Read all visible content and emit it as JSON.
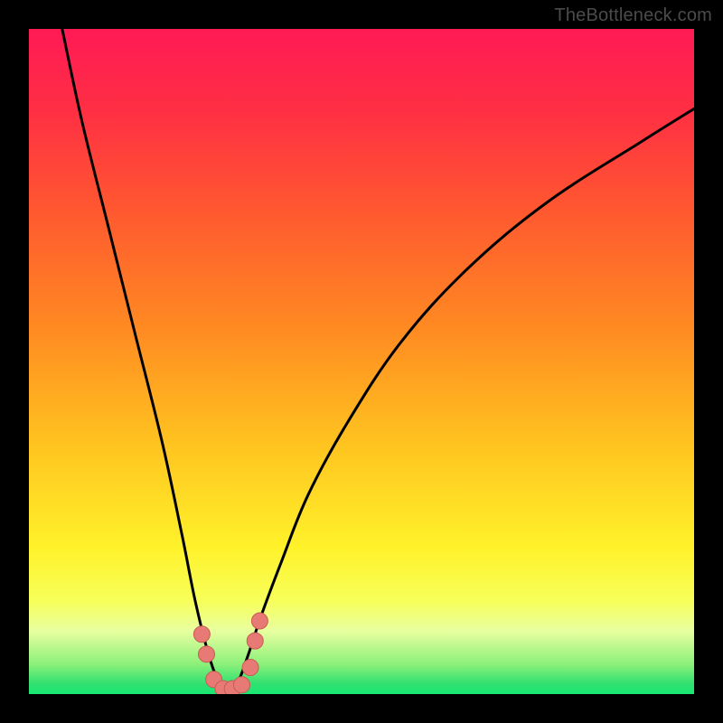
{
  "watermark": "TheBottleneck.com",
  "colors": {
    "frame": "#000000",
    "gradient_stops": [
      {
        "offset": 0.0,
        "color": "#ff1a55"
      },
      {
        "offset": 0.12,
        "color": "#ff2e44"
      },
      {
        "offset": 0.28,
        "color": "#ff5a2f"
      },
      {
        "offset": 0.45,
        "color": "#ff8a22"
      },
      {
        "offset": 0.62,
        "color": "#ffc21f"
      },
      {
        "offset": 0.78,
        "color": "#fff22a"
      },
      {
        "offset": 0.86,
        "color": "#f7ff5a"
      },
      {
        "offset": 0.905,
        "color": "#e8ffa0"
      },
      {
        "offset": 0.955,
        "color": "#8cf07a"
      },
      {
        "offset": 0.985,
        "color": "#2fe070"
      },
      {
        "offset": 1.0,
        "color": "#18e874"
      }
    ],
    "curve": "#000000",
    "marker_fill": "#e77a74",
    "marker_stroke": "#c95b56"
  },
  "chart_data": {
    "type": "line",
    "title": "",
    "xlabel": "",
    "ylabel": "",
    "xlim": [
      0,
      100
    ],
    "ylim": [
      0,
      100
    ],
    "series": [
      {
        "name": "bottleneck-curve",
        "x": [
          5,
          8,
          12,
          16,
          20,
          23,
          25,
          27,
          28.5,
          30,
          31.5,
          33,
          35,
          38,
          42,
          48,
          56,
          66,
          78,
          92,
          100
        ],
        "y": [
          100,
          86,
          70,
          54,
          38,
          24,
          14,
          6,
          2,
          0.5,
          2,
          6,
          12,
          20,
          30,
          41,
          53,
          64,
          74,
          83,
          88
        ]
      }
    ],
    "markers": {
      "name": "trough-markers",
      "points": [
        {
          "x": 26.0,
          "y": 9.0
        },
        {
          "x": 26.7,
          "y": 6.0
        },
        {
          "x": 27.8,
          "y": 2.2
        },
        {
          "x": 29.2,
          "y": 0.8
        },
        {
          "x": 30.6,
          "y": 0.8
        },
        {
          "x": 32.0,
          "y": 1.4
        },
        {
          "x": 33.3,
          "y": 4.0
        },
        {
          "x": 34.0,
          "y": 8.0
        },
        {
          "x": 34.7,
          "y": 11.0
        }
      ]
    }
  }
}
